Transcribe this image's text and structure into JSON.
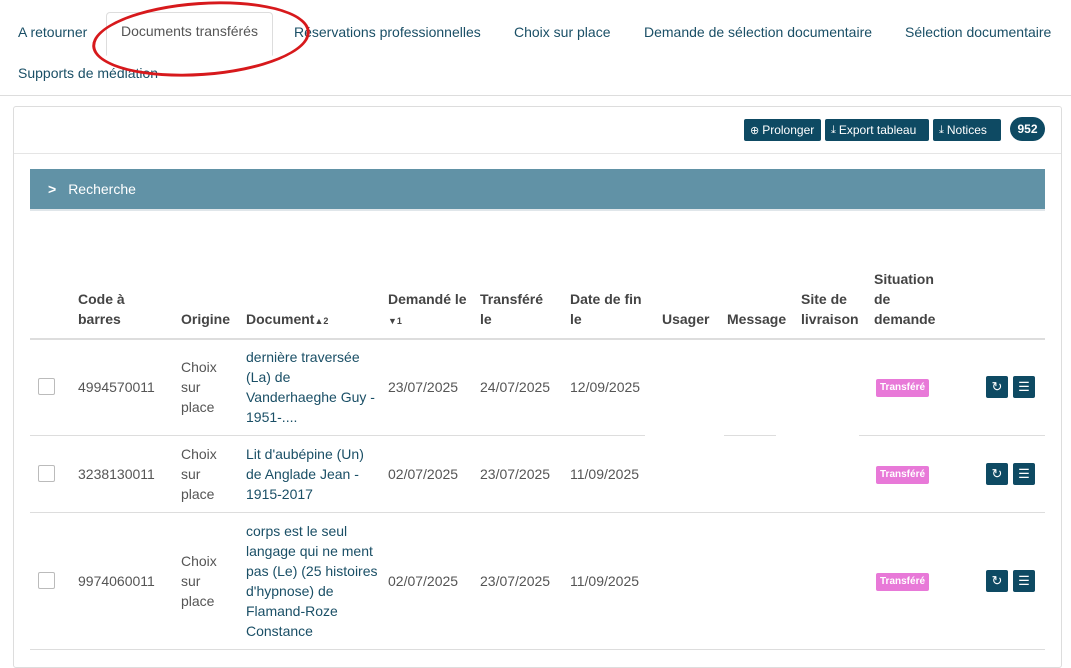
{
  "tabs": [
    {
      "label": "A retourner"
    },
    {
      "label": "Documents transférés"
    },
    {
      "label": "Réservations professionnelles"
    },
    {
      "label": "Choix sur place"
    },
    {
      "label": "Demande de sélection documentaire"
    },
    {
      "label": "Sélection documentaire"
    },
    {
      "label": "Supports de médiation"
    }
  ],
  "toolbar": {
    "prolonger": "Prolonger",
    "export": "Export tableau",
    "notices": "Notices",
    "count": "952"
  },
  "search": {
    "label": "Recherche"
  },
  "columns": {
    "code": "Code à barres",
    "origine": "Origine",
    "document": "Document",
    "document_sort": "2",
    "demande": "Demandé le",
    "demande_sort": "1",
    "transfere": "Transféré le",
    "datefin": "Date de fin le",
    "usager": "Usager",
    "message": "Message",
    "site": "Site de livraison",
    "situation": "Situation de demande"
  },
  "rows": [
    {
      "code": "4994570011",
      "origine": "Choix sur place",
      "document": "dernière traversée (La) de Vanderhaeghe Guy - 1951-....",
      "demande": "23/07/2025",
      "transfere": "24/07/2025",
      "datefin": "12/09/2025",
      "status": "Transféré"
    },
    {
      "code": "3238130011",
      "origine": "Choix sur place",
      "document": "Lit d'aubépine (Un) de Anglade Jean - 1915-2017",
      "demande": "02/07/2025",
      "transfere": "23/07/2025",
      "datefin": "11/09/2025",
      "status": "Transféré"
    },
    {
      "code": "9974060011",
      "origine": "Choix sur place",
      "document": "corps est le seul langage qui ne ment pas (Le) (25 histoires d'hypnose) de Flamand-Roze Constance",
      "demande": "02/07/2025",
      "transfere": "23/07/2025",
      "datefin": "11/09/2025",
      "status": "Transféré"
    }
  ],
  "colors": {
    "primary": "#0e4a63",
    "search_bar": "#6192a6",
    "status": "#e879d8",
    "highlight_circle": "#d7191c"
  },
  "icons": [
    "plus-circle-icon",
    "download-icon",
    "chevron-right-icon",
    "refresh-icon",
    "list-icon"
  ]
}
